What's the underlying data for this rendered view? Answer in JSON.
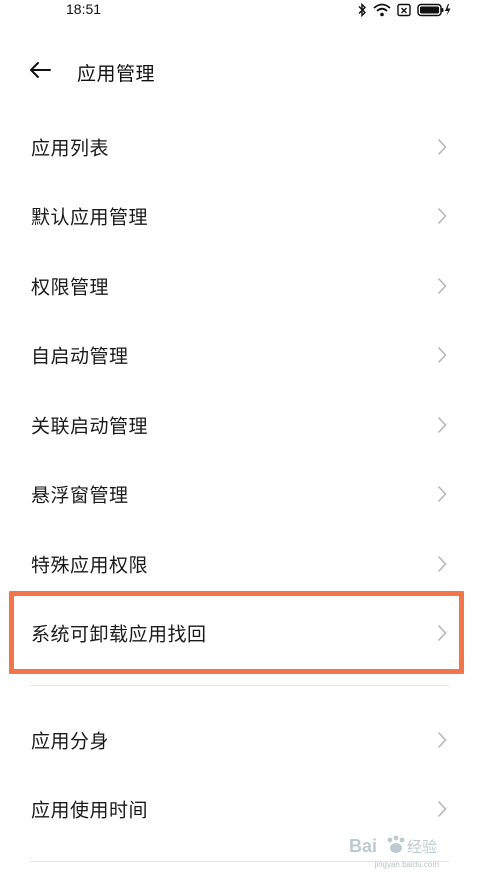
{
  "status_bar": {
    "time": "18:51",
    "icons": [
      "bluetooth-icon",
      "wifi-icon",
      "sim-disabled-icon",
      "battery-charging-icon"
    ]
  },
  "header": {
    "title": "应用管理",
    "back_icon": "back-arrow-icon"
  },
  "menu": {
    "items": [
      {
        "label": "应用列表"
      },
      {
        "label": "默认应用管理"
      },
      {
        "label": "权限管理"
      },
      {
        "label": "自启动管理"
      },
      {
        "label": "关联启动管理"
      },
      {
        "label": "悬浮窗管理"
      },
      {
        "label": "特殊应用权限"
      },
      {
        "label": "系统可卸载应用找回",
        "highlighted": true
      },
      {
        "label": "应用分身"
      },
      {
        "label": "应用使用时间"
      }
    ]
  },
  "watermark": {
    "text": "Baidu经验",
    "sub": "jingyan.baidu.com"
  },
  "colors": {
    "highlight": "#f2764a",
    "divider": "#e4e4e4",
    "chevron": "#b8b8b8"
  }
}
